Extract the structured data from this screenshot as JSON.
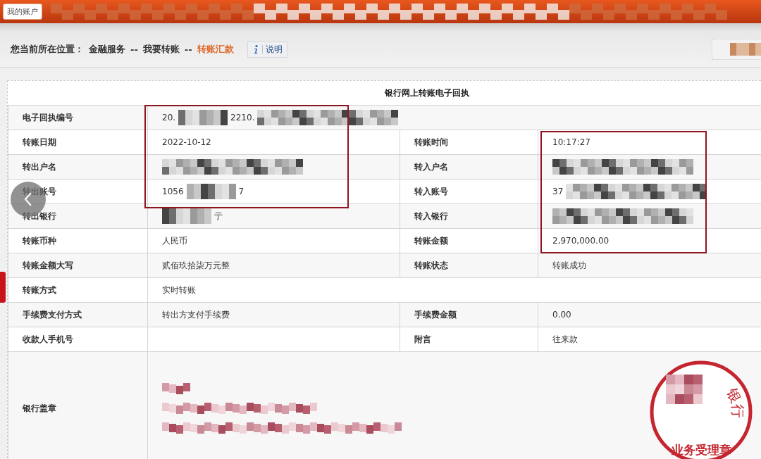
{
  "header": {
    "account_button": "我的账户"
  },
  "breadcrumb": {
    "label": "您当前所在位置：",
    "items": [
      {
        "kind": "link",
        "text": "金融服务"
      },
      {
        "kind": "separator",
        "text": "--"
      },
      {
        "kind": "link",
        "text": "我要转账"
      },
      {
        "kind": "separator",
        "text": "--"
      },
      {
        "kind": "current",
        "text": "转账汇款"
      }
    ],
    "help_button": "说明"
  },
  "receipt": {
    "title": "银行网上转账电子回执",
    "rows": [
      {
        "cells": [
          {
            "label": "电子回执编号",
            "parts": [
              {
                "kind": "text",
                "text": "20."
              },
              {
                "kind": "redacted"
              },
              {
                "kind": "text",
                "text": "2210."
              },
              {
                "kind": "redacted"
              }
            ]
          }
        ]
      },
      {
        "cells": [
          {
            "label": "转账日期",
            "parts": [
              {
                "kind": "text",
                "text": "2022-10-12"
              }
            ]
          },
          {
            "label": "转账时间",
            "parts": [
              {
                "kind": "text",
                "text": "10:17:27"
              }
            ]
          }
        ]
      },
      {
        "cells": [
          {
            "label": "转出户名",
            "parts": [
              {
                "kind": "redacted"
              }
            ]
          },
          {
            "label": "转入户名",
            "parts": [
              {
                "kind": "redacted"
              }
            ]
          }
        ]
      },
      {
        "cells": [
          {
            "label": "转出账号",
            "parts": [
              {
                "kind": "text",
                "text": "1056"
              },
              {
                "kind": "redacted"
              },
              {
                "kind": "text",
                "text": "7"
              }
            ]
          },
          {
            "label": "转入账号",
            "parts": [
              {
                "kind": "text",
                "text": "37"
              },
              {
                "kind": "redacted"
              }
            ]
          }
        ]
      },
      {
        "cells": [
          {
            "label": "转出银行",
            "parts": [
              {
                "kind": "redacted"
              },
              {
                "kind": "text",
                "text": "亍"
              }
            ]
          },
          {
            "label": "转入银行",
            "parts": [
              {
                "kind": "redacted"
              }
            ]
          }
        ]
      },
      {
        "cells": [
          {
            "label": "转账币种",
            "parts": [
              {
                "kind": "text",
                "text": "人民币"
              }
            ]
          },
          {
            "label": "转账金额",
            "parts": [
              {
                "kind": "text",
                "text": "2,970,000.00"
              }
            ]
          }
        ]
      },
      {
        "cells": [
          {
            "label": "转账金额大写",
            "parts": [
              {
                "kind": "text",
                "text": "贰佰玖拾柒万元整"
              }
            ]
          },
          {
            "label": "转账状态",
            "parts": [
              {
                "kind": "text",
                "text": "转账成功"
              }
            ]
          }
        ]
      },
      {
        "cells": [
          {
            "label": "转账方式",
            "parts": [
              {
                "kind": "text",
                "text": "实时转账"
              }
            ]
          }
        ]
      },
      {
        "cells": [
          {
            "label": "手续费支付方式",
            "parts": [
              {
                "kind": "text",
                "text": "转出方支付手续费"
              }
            ]
          },
          {
            "label": "手续费金额",
            "parts": [
              {
                "kind": "text",
                "text": "0.00"
              }
            ]
          }
        ]
      },
      {
        "cells": [
          {
            "label": "收款人手机号"
          },
          {
            "label": "附言",
            "parts": [
              {
                "kind": "text",
                "text": "往来款"
              }
            ]
          }
        ]
      }
    ],
    "seal_row": {
      "label": "银行盖章",
      "lines": [
        {
          "kind": "redacted"
        },
        {
          "kind": "redacted"
        },
        {
          "kind": "redacted"
        }
      ],
      "stamp": {
        "top_text": "银行",
        "bottom_text": "业务受理章"
      }
    }
  }
}
